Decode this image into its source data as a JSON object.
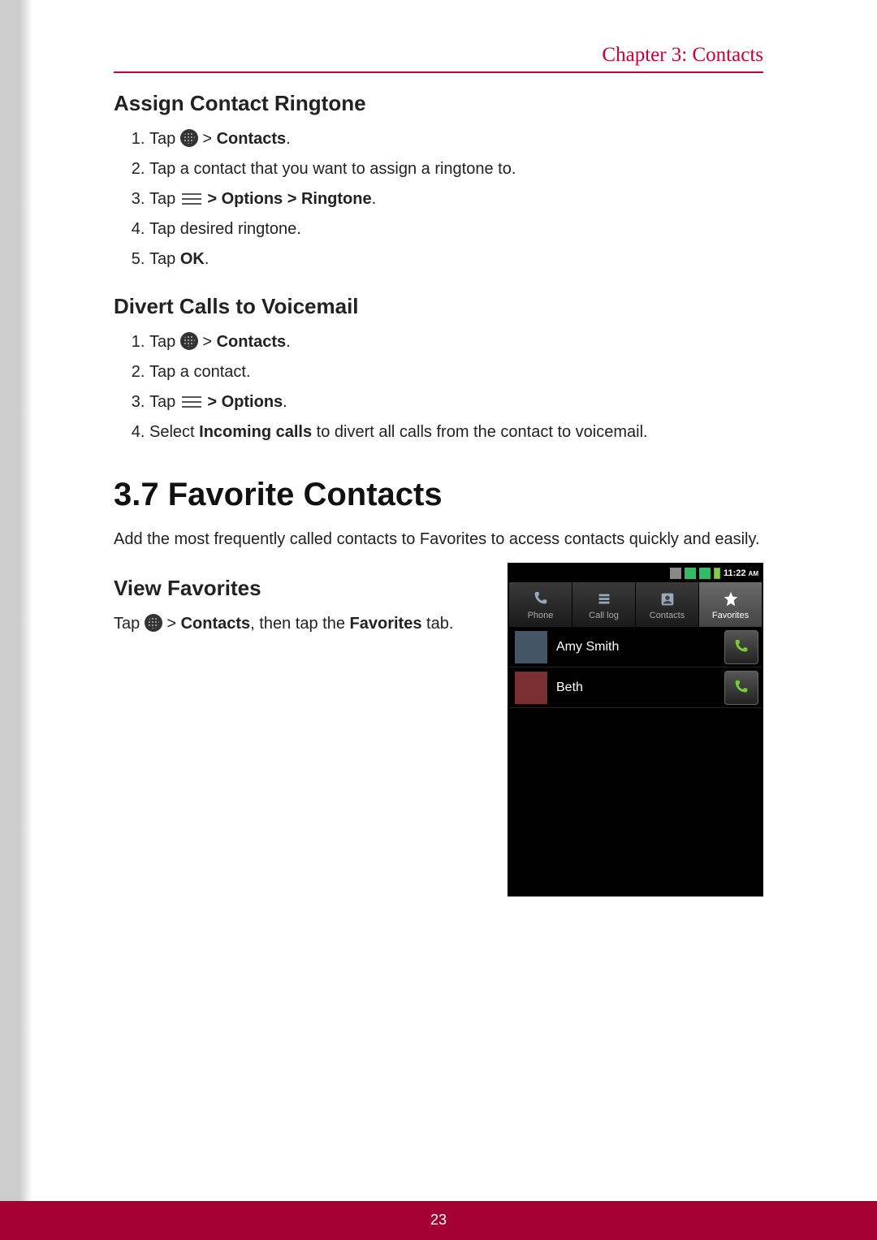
{
  "header": {
    "chapter_label": "Chapter 3: Contacts"
  },
  "section1": {
    "title": "Assign Contact Ringtone",
    "steps": {
      "s1_pre": "Tap ",
      "s1_post": " > ",
      "s1_bold": "Contacts",
      "s1_end": ".",
      "s2": "Tap a contact that you want to assign a ringtone to.",
      "s3_pre": "Tap ",
      "s3_post": " ",
      "s3_bold": "> Options > Ringtone",
      "s3_end": ".",
      "s4": "Tap desired ringtone.",
      "s5_pre": "Tap ",
      "s5_bold": "OK",
      "s5_end": "."
    }
  },
  "section2": {
    "title": "Divert Calls to Voicemail",
    "steps": {
      "s1_pre": "Tap ",
      "s1_post": " > ",
      "s1_bold": "Contacts",
      "s1_end": ".",
      "s2": "Tap a contact.",
      "s3_pre": "Tap ",
      "s3_post": " ",
      "s3_bold": "> Options",
      "s3_end": ".",
      "s4_pre": "Select ",
      "s4_bold": "Incoming calls",
      "s4_post": " to divert all calls from the contact to voicemail."
    }
  },
  "section3": {
    "title": "3.7 Favorite Contacts",
    "intro": "Add the most frequently called contacts to Favorites to access contacts quickly and easily."
  },
  "section4": {
    "title": "View Favorites",
    "line_pre": "Tap ",
    "line_mid1": " > ",
    "line_bold1": "Contacts",
    "line_mid2": ", then tap the ",
    "line_bold2": "Favorites",
    "line_end": " tab."
  },
  "phone": {
    "time": "11:22",
    "ampm": "AM",
    "tabs": [
      {
        "label": "Phone"
      },
      {
        "label": "Call log"
      },
      {
        "label": "Contacts"
      },
      {
        "label": "Favorites"
      }
    ],
    "favorites": [
      {
        "name": "Amy Smith"
      },
      {
        "name": "Beth"
      }
    ]
  },
  "footer": {
    "page": "23"
  }
}
